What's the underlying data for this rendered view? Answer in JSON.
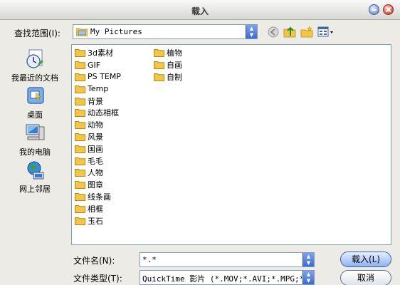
{
  "window": {
    "title": "载入"
  },
  "lookin": {
    "label": "查找范围(I):",
    "value": "My Pictures"
  },
  "toolbar": {
    "icons": [
      "back-icon",
      "up-folder-icon",
      "new-folder-icon",
      "view-menu-icon"
    ]
  },
  "places": [
    {
      "label": "我最近的文档",
      "icon": "recent-documents-icon"
    },
    {
      "label": "桌面",
      "icon": "desktop-icon"
    },
    {
      "label": "我的电脑",
      "icon": "my-computer-icon"
    },
    {
      "label": "网上邻居",
      "icon": "network-places-icon"
    }
  ],
  "files": {
    "col1": [
      "3d素材",
      "GIF",
      "PS TEMP",
      "Temp",
      "背景",
      "动态相框",
      "动物",
      "风景",
      "国画",
      "毛毛",
      "人物",
      "图章",
      "线条画",
      "相框",
      "玉石"
    ],
    "col2": [
      "植物",
      "自画",
      "自制"
    ]
  },
  "filename": {
    "label": "文件名(N):",
    "value": "*.*"
  },
  "filetype": {
    "label": "文件类型(T):",
    "value": "QuickTime 影片 (*.MOV;*.AVI;*.MPG;*.M"
  },
  "buttons": {
    "open": "载入(L)",
    "cancel": "取消"
  },
  "colors": {
    "folder": "#f3c64a",
    "accent": "#3b6bd4"
  }
}
